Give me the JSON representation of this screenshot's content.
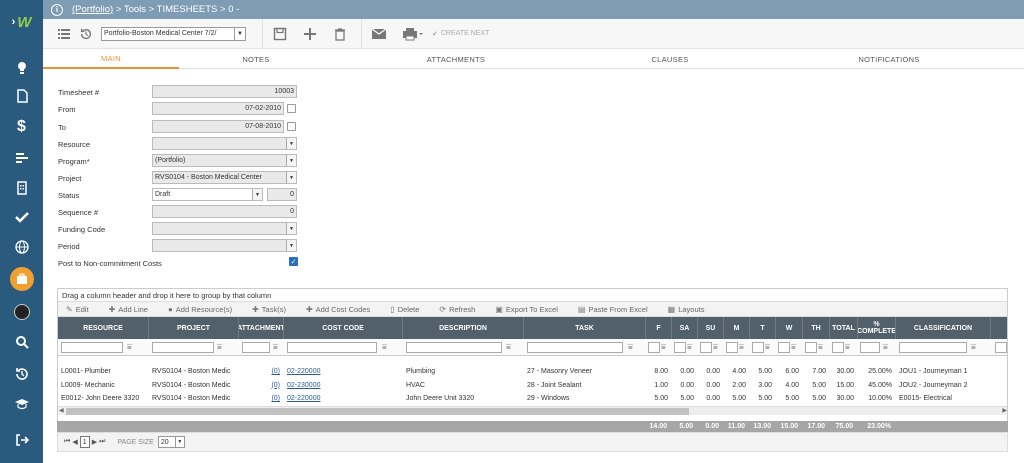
{
  "breadcrumb": {
    "link": "(Portfolio)",
    "rest": " > Tools > TIMESHEETS > 0 -"
  },
  "toolbar": {
    "record_select": "Portfolio-Boston Medical Center 7/2/",
    "create_next": "CREATE NEXT"
  },
  "tabs": [
    "MAIN",
    "NOTES",
    "ATTACHMENTS",
    "CLAUSES",
    "NOTIFICATIONS"
  ],
  "form": {
    "timesheet_label": "Timesheet #",
    "timesheet_value": "10003",
    "from_label": "From",
    "from_value": "07-02-2010",
    "to_label": "To",
    "to_value": "07-08-2010",
    "resource_label": "Resource",
    "resource_value": "",
    "program_label": "Program*",
    "program_value": "(Portfolio)",
    "project_label": "Project",
    "project_value": "RVS0104 - Boston Medical Center",
    "status_label": "Status",
    "status_value": "Draft",
    "status_num": "0",
    "sequence_label": "Sequence #",
    "sequence_value": "0",
    "funding_label": "Funding Code",
    "funding_value": "",
    "period_label": "Period",
    "period_value": "",
    "post_label": "Post to Non-commitment Costs",
    "post_checked": true
  },
  "grid": {
    "group_hint": "Drag a column header and drop it here to group by that column",
    "toolbar": [
      "Edit",
      "Add Line",
      "Add Resource(s)",
      "Task(s)",
      "Add Cost Codes",
      "Delete",
      "Refresh",
      "Export To Excel",
      "Paste From Excel",
      "Layouts"
    ],
    "columns": [
      "RESOURCE",
      "PROJECT",
      "ATTACHMENT",
      "COST CODE",
      "DESCRIPTION",
      "TASK",
      "F",
      "SA",
      "SU",
      "M",
      "T",
      "W",
      "TH",
      "TOTAL",
      "% COMPLETE",
      "CLASSIFICATION"
    ],
    "rows": [
      [
        "L0001- Plumber",
        "RVS0104 - Boston Medic",
        "(0)",
        "02-220000",
        "Plumbing",
        "27 - Masonry Veneer",
        "8.00",
        "0.00",
        "0.00",
        "4.00",
        "5.00",
        "6.00",
        "7.00",
        "30.00",
        "25.00%",
        "JOU1 - Journeyman 1"
      ],
      [
        "L0009- Mechanic",
        "RVS0104 - Boston Medic",
        "(0)",
        "02-230000",
        "HVAC",
        "28 - Joint Sealant",
        "1.00",
        "0.00",
        "0.00",
        "2.00",
        "3.00",
        "4.00",
        "5.00",
        "15.00",
        "45.00%",
        "JOU2 - Journeyman 2"
      ],
      [
        "E0012- John Deere 3320",
        "RVS0104 - Boston Medic",
        "(0)",
        "02-220000",
        "John Deere Unit 3320",
        "29 - Windows",
        "5.00",
        "5.00",
        "0.00",
        "5.00",
        "5.00",
        "5.00",
        "5.00",
        "30.00",
        "10.00%",
        "E0015- Electrical"
      ]
    ],
    "totals": [
      "14.00",
      "5.00",
      "0.00",
      "11.00",
      "13.00",
      "15.00",
      "17.00",
      "75.00",
      "23.00%"
    ]
  },
  "pager": {
    "page": "1",
    "page_size_label": "PAGE SIZE",
    "page_size": "20"
  }
}
